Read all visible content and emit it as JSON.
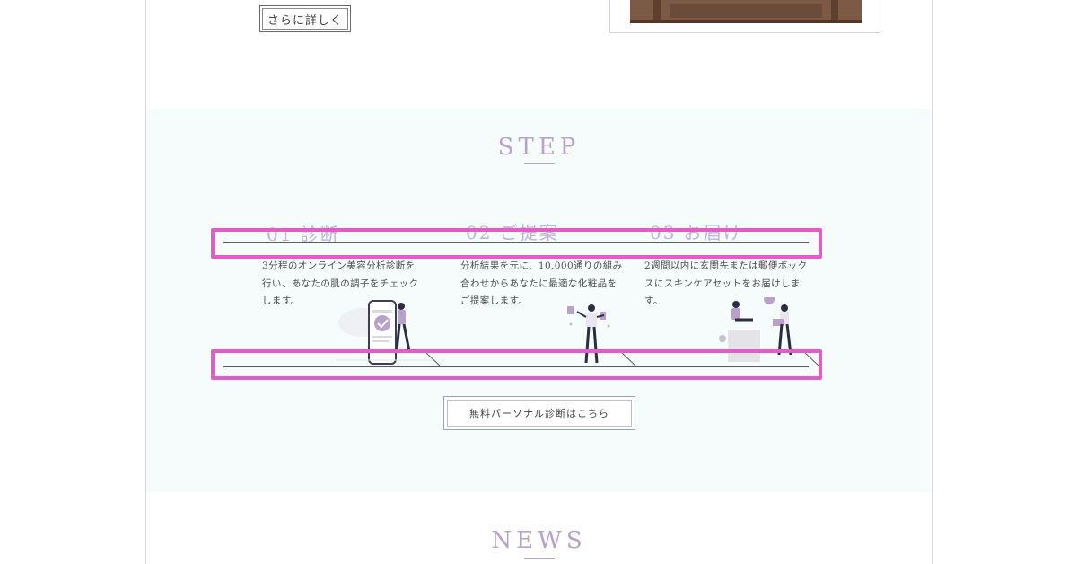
{
  "top": {
    "more_label": "さらに詳しく"
  },
  "step_section": {
    "title": "STEP",
    "steps": [
      {
        "heading": "01 診断",
        "lines": [
          "3分程のオンライン美容分析診断を",
          "行い、あなたの肌の調子をチェック",
          "します。"
        ]
      },
      {
        "heading": "02 ご提案",
        "lines": [
          "分析結果を元に、10,000通りの組み",
          "合わせからあなたに最適な化粧品を",
          "ご提案します。"
        ]
      },
      {
        "heading": "03 お届け",
        "lines": [
          "2週間以内に玄関先または郵便ボック",
          "スにスキンケアセットをお届けしま",
          "す。"
        ]
      }
    ],
    "cta_label": "無料パーソナル診断はこちら"
  },
  "news_section": {
    "title": "NEWS"
  },
  "colors": {
    "accent": "#b7a2cc",
    "section_bg": "#f6fbfc",
    "highlight": "#e55cc8"
  }
}
